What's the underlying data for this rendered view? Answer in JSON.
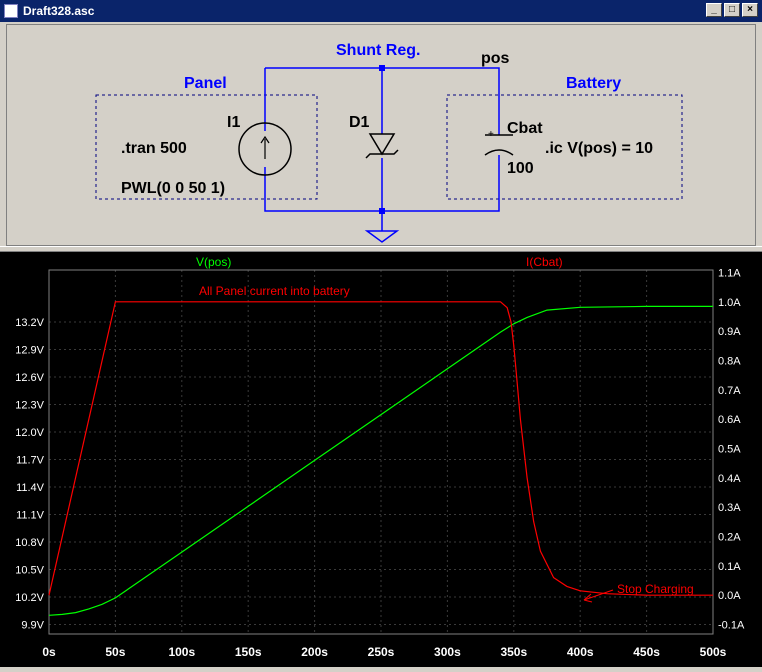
{
  "window": {
    "title": "Draft328.asc",
    "minimize": "_",
    "maximize": "□",
    "close": "×"
  },
  "schematic": {
    "labels": {
      "panel": "Panel",
      "shunt": "Shunt Reg.",
      "pos": "pos",
      "battery": "Battery",
      "i1": "I1",
      "d1": "D1",
      "cbat": "Cbat",
      "tran": ".tran 500",
      "ic": ".ic V(pos) = 10",
      "pwl": "PWL(0 0 50 1)",
      "cap_value": "100",
      "plus": "+"
    },
    "colors": {
      "wire": "#0000ff",
      "label": "#0000ff",
      "text": "#000000",
      "dashed": "#000080"
    }
  },
  "plot": {
    "trace_labels": {
      "vpos": "V(pos)",
      "icbat": "I(Cbat)"
    },
    "annotations": {
      "panel_current": "All Panel current into battery",
      "stop": "Stop Charging"
    },
    "colors": {
      "background": "#000000",
      "grid": "#404040",
      "vpos": "#00ff00",
      "icbat": "#ff0000",
      "axis_text": "#ffffff"
    }
  },
  "chart_data": {
    "type": "line",
    "x_ticks": [
      "0s",
      "50s",
      "100s",
      "150s",
      "200s",
      "250s",
      "300s",
      "350s",
      "400s",
      "450s",
      "500s"
    ],
    "y_left_ticks": [
      "9.9V",
      "10.2V",
      "10.5V",
      "10.8V",
      "11.1V",
      "11.4V",
      "11.7V",
      "12.0V",
      "12.3V",
      "12.6V",
      "12.9V",
      "13.2V"
    ],
    "y_right_ticks": [
      "-0.1A",
      "0.0A",
      "0.1A",
      "0.2A",
      "0.3A",
      "0.4A",
      "0.5A",
      "0.6A",
      "0.7A",
      "0.8A",
      "0.9A",
      "1.0A",
      "1.1A"
    ],
    "xlim": [
      0,
      500
    ],
    "ylim_left": [
      9.9,
      13.5
    ],
    "ylim_right": [
      -0.1,
      1.1
    ],
    "series": [
      {
        "name": "V(pos)",
        "axis": "left",
        "x": [
          0,
          10,
          20,
          30,
          40,
          50,
          75,
          100,
          150,
          200,
          250,
          300,
          340,
          350,
          360,
          375,
          400,
          450,
          500
        ],
        "y": [
          10.0,
          10.01,
          10.03,
          10.07,
          10.12,
          10.19,
          10.44,
          10.69,
          11.19,
          11.69,
          12.19,
          12.69,
          13.09,
          13.18,
          13.25,
          13.33,
          13.36,
          13.37,
          13.37
        ]
      },
      {
        "name": "I(Cbat)",
        "axis": "right",
        "x": [
          0,
          50,
          100,
          200,
          300,
          340,
          345,
          348,
          350,
          352,
          355,
          360,
          365,
          370,
          380,
          390,
          400,
          420,
          450,
          500
        ],
        "y": [
          0.0,
          1.0,
          1.0,
          1.0,
          1.0,
          1.0,
          0.98,
          0.93,
          0.85,
          0.75,
          0.6,
          0.4,
          0.25,
          0.15,
          0.06,
          0.03,
          0.015,
          0.005,
          0.0,
          0.0
        ]
      }
    ]
  }
}
